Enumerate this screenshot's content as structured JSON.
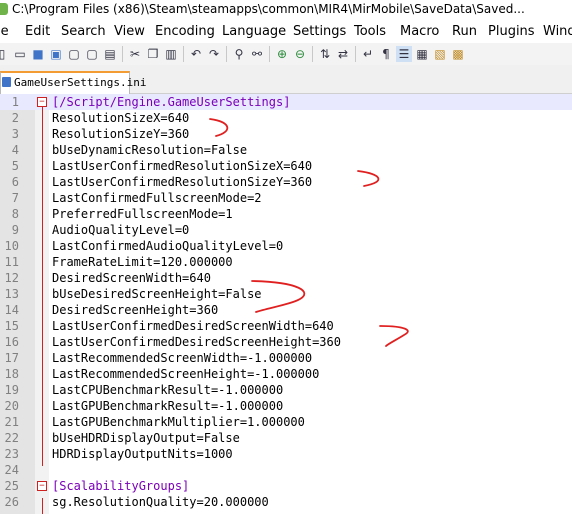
{
  "window": {
    "title": "C:\\Program Files (x86)\\Steam\\steamapps\\common\\MIR4\\MirMobile\\SaveData\\Saved..."
  },
  "menu": [
    "le",
    "Edit",
    "Search",
    "View",
    "Encoding",
    "Language",
    "Settings",
    "Tools",
    "Macro",
    "Run",
    "Plugins",
    "Wind"
  ],
  "toolbar_icons": [
    "new-file",
    "open-file",
    "save",
    "save-all",
    "close",
    "close-all",
    "print",
    "cut",
    "copy",
    "paste",
    "undo",
    "redo",
    "find",
    "replace",
    "zoom-in",
    "zoom-out",
    "sync-vertical",
    "sync-horizontal",
    "word-wrap",
    "show-all-chars",
    "indent-guide",
    "doc-map",
    "function-list",
    "folder-workspace"
  ],
  "tab": {
    "label": "GameUserSettings.ini"
  },
  "editor": {
    "lines": [
      {
        "n": "1",
        "text": "[/Script/Engine.GameUserSettings]",
        "section": true
      },
      {
        "n": "2",
        "text": "ResolutionSizeX=640"
      },
      {
        "n": "3",
        "text": "ResolutionSizeY=360"
      },
      {
        "n": "4",
        "text": "bUseDynamicResolution=False"
      },
      {
        "n": "5",
        "text": "LastUserConfirmedResolutionSizeX=640"
      },
      {
        "n": "6",
        "text": "LastUserConfirmedResolutionSizeY=360"
      },
      {
        "n": "7",
        "text": "LastConfirmedFullscreenMode=2"
      },
      {
        "n": "8",
        "text": "PreferredFullscreenMode=1"
      },
      {
        "n": "9",
        "text": "AudioQualityLevel=0"
      },
      {
        "n": "10",
        "text": "LastConfirmedAudioQualityLevel=0"
      },
      {
        "n": "11",
        "text": "FrameRateLimit=120.000000"
      },
      {
        "n": "12",
        "text": "DesiredScreenWidth=640"
      },
      {
        "n": "13",
        "text": "bUseDesiredScreenHeight=False"
      },
      {
        "n": "14",
        "text": "DesiredScreenHeight=360"
      },
      {
        "n": "15",
        "text": "LastUserConfirmedDesiredScreenWidth=640"
      },
      {
        "n": "16",
        "text": "LastUserConfirmedDesiredScreenHeight=360"
      },
      {
        "n": "17",
        "text": "LastRecommendedScreenWidth=-1.000000"
      },
      {
        "n": "18",
        "text": "LastRecommendedScreenHeight=-1.000000"
      },
      {
        "n": "19",
        "text": "LastCPUBenchmarkResult=-1.000000"
      },
      {
        "n": "20",
        "text": "LastGPUBenchmarkResult=-1.000000"
      },
      {
        "n": "21",
        "text": "LastGPUBenchmarkMultiplier=1.000000"
      },
      {
        "n": "22",
        "text": "bUseHDRDisplayOutput=False"
      },
      {
        "n": "23",
        "text": "HDRDisplayOutputNits=1000"
      },
      {
        "n": "24",
        "text": ""
      },
      {
        "n": "25",
        "text": "[ScalabilityGroups]",
        "section": true
      },
      {
        "n": "26",
        "text": "sg.ResolutionQuality=20.000000"
      }
    ]
  },
  "colors": {
    "annotation": "#e02020",
    "section": "#7a00b8",
    "fold_marker": "#d02020"
  }
}
